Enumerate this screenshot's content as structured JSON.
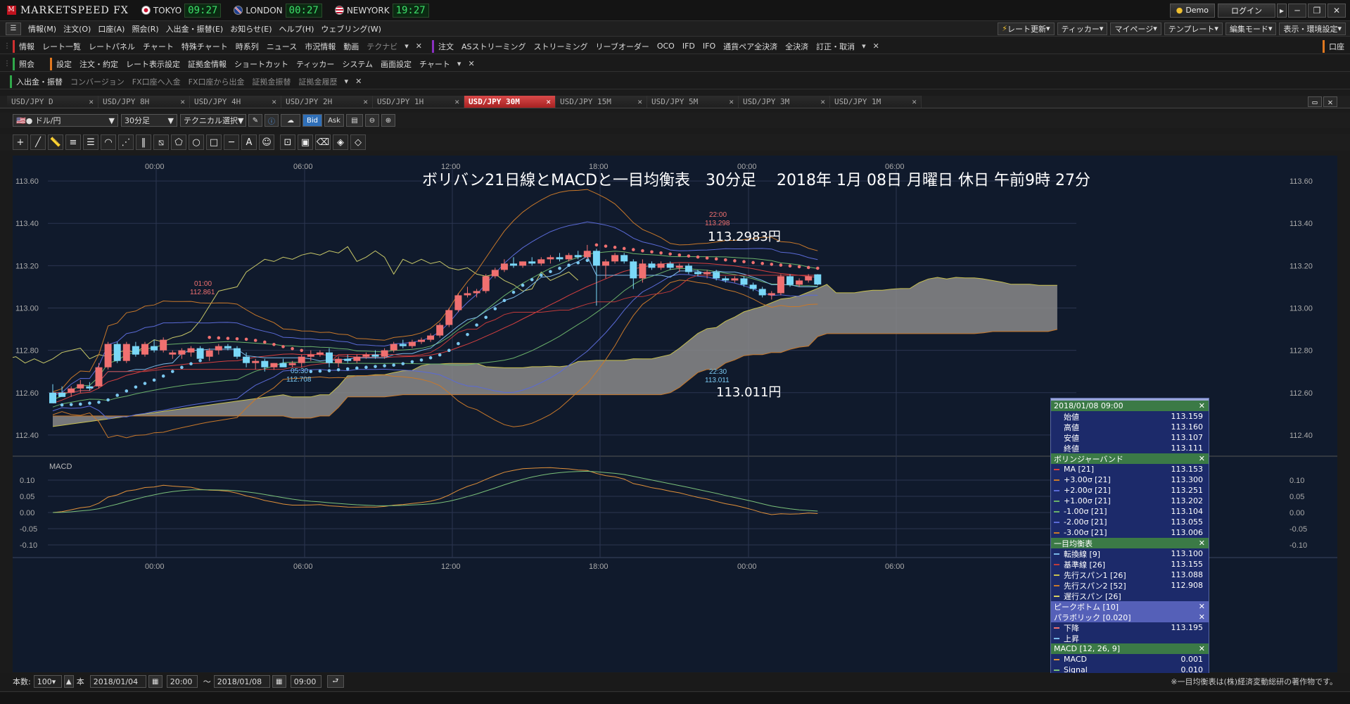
{
  "app": {
    "name": "MARKETSPEED FX",
    "logo_mark": "M"
  },
  "clocks": [
    {
      "city": "TOKYO",
      "time": "09:27",
      "flag_color": "#c8102e"
    },
    {
      "city": "LONDON",
      "time": "00:27",
      "flag_color": "#1f3f8f"
    },
    {
      "city": "NEWYORK",
      "time": "19:27",
      "flag_color": "#2b4f9c"
    }
  ],
  "title_buttons": {
    "demo": "Demo",
    "login": "ログイン"
  },
  "menu": [
    "情報(M)",
    "注文(O)",
    "口座(A)",
    "照会(R)",
    "入出金・振替(E)",
    "お知らせ(E)",
    "ヘルプ(H)",
    "ウェブリング(W)"
  ],
  "menu_right": [
    "レート更新",
    "ティッカー",
    "マイページ",
    "テンプレート",
    "編集モード",
    "表示・環境設定"
  ],
  "toolbar1": {
    "info_label": "情報",
    "info_items": [
      "レート一覧",
      "レートパネル",
      "チャート",
      "特殊チャート",
      "時系列",
      "ニュース",
      "市況情報",
      "動画"
    ],
    "info_dim": "テクナビ",
    "order_label": "注文",
    "order_items": [
      "ASストリーミング",
      "ストリーミング",
      "リーブオーダー",
      "OCO",
      "IFD",
      "IFO",
      "通貨ペア全決済",
      "全決済",
      "訂正・取消"
    ],
    "account_label": "口座"
  },
  "toolbar2": {
    "ref_label": "照会",
    "settings_label": "設定",
    "settings_items": [
      "注文・約定",
      "レート表示設定",
      "証拠金情報",
      "ショートカット",
      "ティッカー",
      "システム",
      "画面設定",
      "チャート"
    ]
  },
  "toolbar3": {
    "label": "入出金・振替",
    "items": [
      "コンバージョン",
      "FX口座へ入金",
      "FX口座から出金",
      "証拠金振替",
      "証拠金履歴"
    ]
  },
  "tabs": [
    "USD/JPY D",
    "USD/JPY 8H",
    "USD/JPY 4H",
    "USD/JPY 2H",
    "USD/JPY 1H",
    "USD/JPY 30M",
    "USD/JPY 15M",
    "USD/JPY 5M",
    "USD/JPY 3M",
    "USD/JPY 1M"
  ],
  "active_tab": 5,
  "controls": {
    "pair": "ドル/円",
    "timeframe": "30分足",
    "technical": "テクニカル選択",
    "bid": "Bid",
    "ask": "Ask"
  },
  "chart_data": {
    "type": "candlestick",
    "title": "ボリバン21日線とMACDと一目均衡表　30分足　 2018年 1月 08日 月曜日 休日 午前9時 27分",
    "y_ticks": [
      "113.60",
      "113.40",
      "113.20",
      "113.00",
      "112.80",
      "112.60",
      "112.40"
    ],
    "ylim": [
      112.3,
      113.72
    ],
    "x_ticks": [
      "00:00",
      "06:00",
      "12:00",
      "18:00",
      "00:00",
      "06:00"
    ],
    "candles": [
      [
        112.6,
        112.64,
        112.56,
        112.55
      ],
      [
        112.6,
        112.63,
        112.59,
        112.58
      ],
      [
        112.6,
        112.63,
        112.58,
        112.62
      ],
      [
        112.62,
        112.66,
        112.6,
        112.64
      ],
      [
        112.63,
        112.65,
        112.61,
        112.62
      ],
      [
        112.63,
        112.74,
        112.62,
        112.72
      ],
      [
        112.72,
        112.84,
        112.71,
        112.83
      ],
      [
        112.83,
        112.84,
        112.74,
        112.75
      ],
      [
        112.75,
        112.84,
        112.74,
        112.83
      ],
      [
        112.82,
        112.84,
        112.77,
        112.78
      ],
      [
        112.78,
        112.84,
        112.77,
        112.83
      ],
      [
        112.82,
        112.85,
        112.79,
        112.8
      ],
      [
        112.8,
        112.861,
        112.79,
        112.85
      ],
      [
        112.78,
        112.8,
        112.76,
        112.79
      ],
      [
        112.78,
        112.81,
        112.76,
        112.8
      ],
      [
        112.79,
        112.82,
        112.77,
        112.81
      ],
      [
        112.81,
        112.82,
        112.76,
        112.76
      ],
      [
        112.77,
        112.81,
        112.75,
        112.8
      ],
      [
        112.8,
        112.83,
        112.78,
        112.82
      ],
      [
        112.82,
        112.83,
        112.8,
        112.81
      ],
      [
        112.81,
        112.82,
        112.76,
        112.77
      ],
      [
        112.77,
        112.79,
        112.72,
        112.74
      ],
      [
        112.74,
        112.76,
        112.71,
        112.75
      ],
      [
        112.75,
        112.76,
        112.7,
        112.72
      ],
      [
        112.72,
        112.74,
        112.708,
        112.74
      ],
      [
        112.74,
        112.76,
        112.73,
        112.72
      ],
      [
        112.73,
        112.75,
        112.72,
        112.74
      ],
      [
        112.74,
        112.78,
        112.72,
        112.77
      ],
      [
        112.77,
        112.8,
        112.75,
        112.78
      ],
      [
        112.78,
        112.8,
        112.77,
        112.79
      ],
      [
        112.79,
        112.81,
        112.72,
        112.74
      ],
      [
        112.74,
        112.77,
        112.72,
        112.76
      ],
      [
        112.76,
        112.78,
        112.74,
        112.75
      ],
      [
        112.75,
        112.78,
        112.74,
        112.77
      ],
      [
        112.77,
        112.79,
        112.76,
        112.78
      ],
      [
        112.78,
        112.8,
        112.76,
        112.77
      ],
      [
        112.77,
        112.81,
        112.76,
        112.8
      ],
      [
        112.8,
        112.84,
        112.79,
        112.83
      ],
      [
        112.83,
        112.85,
        112.81,
        112.82
      ],
      [
        112.82,
        112.85,
        112.81,
        112.84
      ],
      [
        112.84,
        112.86,
        112.83,
        112.85
      ],
      [
        112.85,
        112.88,
        112.84,
        112.87
      ],
      [
        112.87,
        112.93,
        112.86,
        112.92
      ],
      [
        112.92,
        113.0,
        112.91,
        112.99
      ],
      [
        112.99,
        113.07,
        112.98,
        113.06
      ],
      [
        113.06,
        113.1,
        113.05,
        113.07
      ],
      [
        113.07,
        113.09,
        113.05,
        113.08
      ],
      [
        113.08,
        113.16,
        113.07,
        113.15
      ],
      [
        113.15,
        113.19,
        113.14,
        113.18
      ],
      [
        113.18,
        113.23,
        113.17,
        113.21
      ],
      [
        113.21,
        113.24,
        113.19,
        113.2
      ],
      [
        113.2,
        113.22,
        113.19,
        113.22
      ],
      [
        113.22,
        113.24,
        113.2,
        113.21
      ],
      [
        113.21,
        113.24,
        113.2,
        113.23
      ],
      [
        113.23,
        113.25,
        113.21,
        113.24
      ],
      [
        113.24,
        113.26,
        113.22,
        113.23
      ],
      [
        113.23,
        113.26,
        113.22,
        113.25
      ],
      [
        113.25,
        113.27,
        113.23,
        113.24
      ],
      [
        113.24,
        113.298,
        113.23,
        113.27
      ],
      [
        113.27,
        113.28,
        113.011,
        113.2
      ],
      [
        113.2,
        113.23,
        113.14,
        113.22
      ],
      [
        113.22,
        113.26,
        113.21,
        113.25
      ],
      [
        113.25,
        113.26,
        113.21,
        113.22
      ],
      [
        113.22,
        113.23,
        113.09,
        113.14
      ],
      [
        113.14,
        113.23,
        113.12,
        113.21
      ],
      [
        113.21,
        113.22,
        113.18,
        113.19
      ],
      [
        113.19,
        113.22,
        113.18,
        113.21
      ],
      [
        113.21,
        113.22,
        113.18,
        113.19
      ],
      [
        113.19,
        113.21,
        113.17,
        113.2
      ],
      [
        113.2,
        113.21,
        113.16,
        113.17
      ],
      [
        113.17,
        113.18,
        113.15,
        113.16
      ],
      [
        113.16,
        113.18,
        113.14,
        113.17
      ],
      [
        113.17,
        113.18,
        113.13,
        113.14
      ],
      [
        113.14,
        113.15,
        113.12,
        113.13
      ],
      [
        113.13,
        113.15,
        113.12,
        113.14
      ],
      [
        113.14,
        113.15,
        113.1,
        113.11
      ],
      [
        113.11,
        113.12,
        113.08,
        113.09
      ],
      [
        113.09,
        113.1,
        113.05,
        113.06
      ],
      [
        113.06,
        113.08,
        113.04,
        113.07
      ],
      [
        113.07,
        113.16,
        113.06,
        113.15
      ],
      [
        113.15,
        113.16,
        113.1,
        113.11
      ],
      [
        113.11,
        113.14,
        113.1,
        113.13
      ],
      [
        113.13,
        113.16,
        113.12,
        113.15
      ],
      [
        113.159,
        113.16,
        113.107,
        113.111
      ]
    ],
    "annotations": [
      {
        "time": "01:00",
        "price": "112.861"
      },
      {
        "time": "05:30",
        "price": "112.708"
      },
      {
        "time": "22:00",
        "price": "113.298"
      },
      {
        "time": "22:30",
        "price": "113.011"
      }
    ],
    "big_labels": {
      "high": "113.2983円",
      "low": "113.011円"
    },
    "macd": {
      "label": "MACD",
      "y_ticks": [
        "0.10",
        "0.05",
        "0.00",
        "-0.05",
        "-0.10"
      ]
    }
  },
  "info_panel": {
    "datetime": "2018/01/08 09:00",
    "ohlc": [
      [
        "始値",
        "113.159"
      ],
      [
        "高値",
        "113.160"
      ],
      [
        "安値",
        "113.107"
      ],
      [
        "終値",
        "113.111"
      ]
    ],
    "bb_title": "ボリンジャーバンド",
    "bb": [
      [
        "MA [21]",
        "113.153",
        "#d64040"
      ],
      [
        "+3.00σ [21]",
        "113.300",
        "#c8782a"
      ],
      [
        "+2.00σ [21]",
        "113.251",
        "#5a6ad6"
      ],
      [
        "+1.00σ [21]",
        "113.202",
        "#6ab06a"
      ],
      [
        "-1.00σ [21]",
        "113.104",
        "#6ab06a"
      ],
      [
        "-2.00σ [21]",
        "113.055",
        "#5a6ad6"
      ],
      [
        "-3.00σ [21]",
        "113.006",
        "#c8782a"
      ]
    ],
    "ich_title": "一目均衡表",
    "ich": [
      [
        "転換線 [9]",
        "113.100",
        "#7ab8e8"
      ],
      [
        "基準線 [26]",
        "113.155",
        "#c03a3a"
      ],
      [
        "先行スパン1 [26]",
        "113.088",
        "#c8c050"
      ],
      [
        "先行スパン2 [52]",
        "112.908",
        "#c8782a"
      ],
      [
        "遅行スパン [26]",
        "",
        "#d8d060"
      ]
    ],
    "peak_title": "ピークボトム [10]",
    "psar_title": "パラボリック [0.020]",
    "psar": [
      [
        "下降",
        "113.195",
        "#f07070"
      ],
      [
        "上昇",
        "",
        "#7ab8e8"
      ]
    ],
    "macd_title": "MACD [12, 26, 9]",
    "macd": [
      [
        "MACD",
        "0.001",
        "#e0903a"
      ],
      [
        "Signal",
        "0.010",
        "#7ac07a"
      ]
    ]
  },
  "footer": {
    "count_label": "本数:",
    "count": "100",
    "unit": "本",
    "from_date": "2018/01/04",
    "from_time": "20:00",
    "tilde": "〜",
    "to_date": "2018/01/08",
    "to_time": "09:00",
    "note": "※一目均衡表は(株)経済変動総研の著作物です。"
  }
}
